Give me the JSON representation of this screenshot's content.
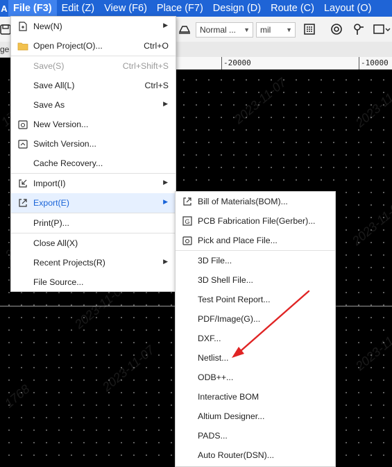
{
  "menubar": {
    "logo": "A",
    "items": [
      "File (F3)",
      "Edit (Z)",
      "View (F6)",
      "Place (F7)",
      "Design (D)",
      "Route (C)",
      "Layout (O)"
    ]
  },
  "toolbar": {
    "line_style_select": "Normal ...",
    "unit_select": "mil"
  },
  "tab": {
    "partial_label": "ge"
  },
  "ruler": {
    "labels": [
      "-20000",
      "-10000"
    ]
  },
  "watermark": [
    "1768",
    "2023-11-07"
  ],
  "file_menu": {
    "items": [
      {
        "label": "New(N)",
        "icon": "new-file-icon",
        "submenu": true
      },
      {
        "label": "Open Project(O)...",
        "icon": "folder-icon",
        "shortcut": "Ctrl+O"
      },
      {
        "label": "Save(S)",
        "shortcut": "Ctrl+Shift+S",
        "disabled": true
      },
      {
        "label": "Save All(L)",
        "shortcut": "Ctrl+S"
      },
      {
        "label": "Save As",
        "submenu": true
      },
      {
        "label": "New Version...",
        "icon": "version-icon"
      },
      {
        "label": "Switch Version...",
        "icon": "switch-version-icon"
      },
      {
        "label": "Cache Recovery..."
      },
      {
        "label": "Import(I)",
        "icon": "import-icon",
        "submenu": true
      },
      {
        "label": "Export(E)",
        "icon": "export-icon",
        "submenu": true,
        "highlighted": true
      },
      {
        "label": "Print(P)..."
      },
      {
        "label": "Close All(X)"
      },
      {
        "label": "Recent Projects(R)",
        "submenu": true
      },
      {
        "label": "File Source..."
      }
    ]
  },
  "export_menu": {
    "items": [
      {
        "label": "Bill of Materials(BOM)...",
        "icon": "export-icon"
      },
      {
        "label": "PCB Fabrication File(Gerber)...",
        "icon": "gerber-icon"
      },
      {
        "label": "Pick and Place File...",
        "icon": "pick-place-icon"
      },
      {
        "label": "3D File..."
      },
      {
        "label": "3D Shell File..."
      },
      {
        "label": "Test Point Report..."
      },
      {
        "label": "PDF/Image(G)..."
      },
      {
        "label": "DXF..."
      },
      {
        "label": "Netlist..."
      },
      {
        "label": "ODB++..."
      },
      {
        "label": "Interactive BOM"
      },
      {
        "label": "Altium Designer..."
      },
      {
        "label": "PADS..."
      },
      {
        "label": "Auto Router(DSN)..."
      }
    ]
  },
  "colors": {
    "menubar_bg": "#1f64d6",
    "menubar_active": "#3f82ee",
    "highlight_bg": "#e6f0ff",
    "highlight_text": "#1a64d8",
    "annotation_arrow": "#e02424"
  }
}
